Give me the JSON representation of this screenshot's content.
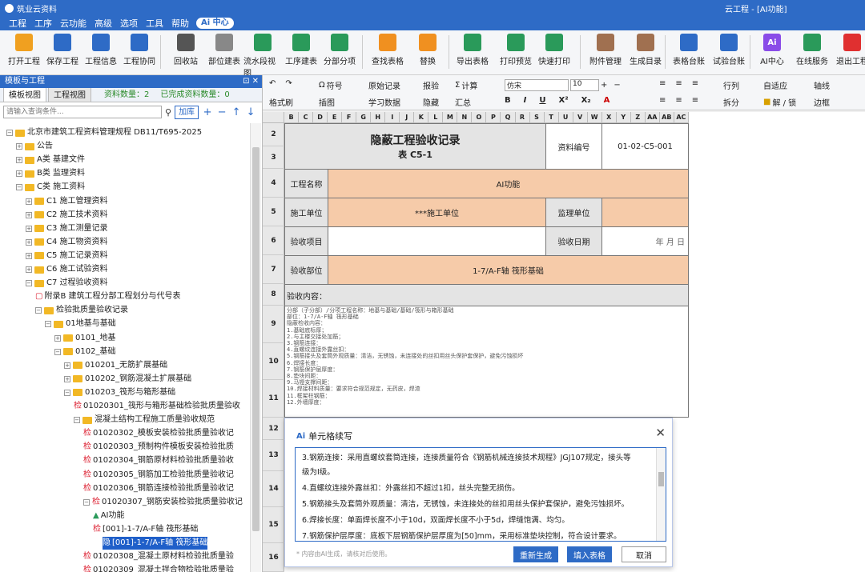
{
  "window": {
    "app_name": "筑业云资料",
    "title": "云工程 - [AI功能]"
  },
  "menu": [
    "工程",
    "工序",
    "云功能",
    "高级",
    "选项",
    "工具",
    "帮助"
  ],
  "menu_ai": "Ai 中心",
  "ribbon": {
    "items": [
      "打开工程",
      "保存工程",
      "工程信息",
      "工程协同",
      "回收站",
      "部位建表",
      "流水段视图",
      "工序建表",
      "分部分项",
      "查找表格",
      "替换",
      "导出表格",
      "打印预览",
      "快速打印",
      "附件管理",
      "生成目录",
      "表格台账",
      "试验台账",
      "AI中心",
      "在线服务",
      "退出工程"
    ]
  },
  "panel": {
    "title": "模板与工程",
    "tabs": [
      "模板视图",
      "工程视图"
    ],
    "material_count": "资料数量：2",
    "done_count": "已完成资料数量：0",
    "search_placeholder": "请输入查询条件...",
    "add_label": "加库"
  },
  "tree": [
    {
      "label": "北京市建筑工程资料管理规程 DB11/T695-2025",
      "level": 0,
      "type": "folder",
      "toggle": "−"
    },
    {
      "label": "公告",
      "level": 1,
      "type": "folder",
      "toggle": "+"
    },
    {
      "label": "A类 基建文件",
      "level": 1,
      "type": "folder",
      "toggle": "+"
    },
    {
      "label": "B类 监理资料",
      "level": 1,
      "type": "folder",
      "toggle": "+"
    },
    {
      "label": "C类 施工资料",
      "level": 1,
      "type": "folder",
      "toggle": "−"
    },
    {
      "label": "C1 施工管理资料",
      "level": 2,
      "type": "folder",
      "toggle": "+"
    },
    {
      "label": "C2 施工技术资料",
      "level": 2,
      "type": "folder",
      "toggle": "+"
    },
    {
      "label": "C3 施工测量记录",
      "level": 2,
      "type": "folder",
      "toggle": "+"
    },
    {
      "label": "C4 施工物资资料",
      "level": 2,
      "type": "folder",
      "toggle": "+"
    },
    {
      "label": "C5 施工记录资料",
      "level": 2,
      "type": "folder",
      "toggle": "+"
    },
    {
      "label": "C6 施工试验资料",
      "level": 2,
      "type": "folder",
      "toggle": "+"
    },
    {
      "label": "C7 过程验收资料",
      "level": 2,
      "type": "folder",
      "toggle": "−"
    },
    {
      "label": "附录B 建筑工程分部工程划分与代号表",
      "level": 3,
      "type": "pdf",
      "toggle": ""
    },
    {
      "label": "检验批质量验收记录",
      "level": 3,
      "type": "folder",
      "toggle": "−"
    },
    {
      "label": "01地基与基础",
      "level": 4,
      "type": "folder",
      "toggle": "−"
    },
    {
      "label": "0101_地基",
      "level": 5,
      "type": "folder",
      "toggle": "+"
    },
    {
      "label": "0102_基础",
      "level": 5,
      "type": "folder",
      "toggle": "−"
    },
    {
      "label": "010201_无筋扩展基础",
      "level": 6,
      "type": "folder",
      "toggle": "+"
    },
    {
      "label": "010202_钢筋混凝土扩展基础",
      "level": 6,
      "type": "folder",
      "toggle": "+"
    },
    {
      "label": "010203_筏形与箱形基础",
      "level": 6,
      "type": "folder",
      "toggle": "−"
    },
    {
      "label": "01020301_筏形与箱形基础检验批质量验收",
      "level": 7,
      "type": "jian",
      "toggle": ""
    },
    {
      "label": "混凝土结构工程施工质量验收规范",
      "level": 7,
      "type": "folder",
      "toggle": "−"
    },
    {
      "label": "01020302_模板安装检验批质量验收记",
      "level": 8,
      "type": "jian",
      "toggle": ""
    },
    {
      "label": "01020303_预制构件模板安装检验批质",
      "level": 8,
      "type": "jian",
      "toggle": ""
    },
    {
      "label": "01020304_钢筋原材料检验批质量验收",
      "level": 8,
      "type": "jian",
      "toggle": ""
    },
    {
      "label": "01020305_钢筋加工检验批质量验收记",
      "level": 8,
      "type": "jian",
      "toggle": ""
    },
    {
      "label": "01020306_钢筋连接检验批质量验收记",
      "level": 8,
      "type": "jian",
      "toggle": ""
    },
    {
      "label": "01020307_钢筋安装检验批质量验收记",
      "level": 8,
      "type": "jian",
      "toggle": "−"
    },
    {
      "label": "AI功能",
      "level": 9,
      "type": "home",
      "toggle": ""
    },
    {
      "label": "[001]-1-7/A-F轴 筏形基础",
      "level": 9,
      "type": "jian",
      "toggle": ""
    },
    {
      "label": "[001]-1-7/A-F轴 筏形基础",
      "level": 10,
      "type": "yin",
      "toggle": "",
      "selected": true
    },
    {
      "label": "01020308_混凝土原材料检验批质量验",
      "level": 8,
      "type": "jian",
      "toggle": ""
    },
    {
      "label": "01020309_混凝土拌合物检验批质量验",
      "level": 8,
      "type": "jian",
      "toggle": ""
    }
  ],
  "toolbar2": {
    "symbol": "符号",
    "original_record": "原始记录",
    "report": "报验",
    "calc": "计算",
    "font": "仿宋",
    "size": "10",
    "rowcol": "行列",
    "autofit": "自适应",
    "axis": "轴线",
    "format_brush": "格式刷",
    "illustration": "插图",
    "learn_data": "学习数据",
    "hide": "隐藏",
    "summary": "汇总",
    "split": "拆分",
    "unlock": "解 / 锁",
    "border": "边框"
  },
  "columns": [
    "B",
    "C",
    "D",
    "E",
    "F",
    "G",
    "H",
    "I",
    "J",
    "K",
    "L",
    "M",
    "N",
    "O",
    "P",
    "Q",
    "R",
    "S",
    "T",
    "U",
    "V",
    "W",
    "X",
    "Y",
    "Z",
    "AA",
    "AB",
    "AC"
  ],
  "rows": [
    "2",
    "3",
    "4",
    "5",
    "6",
    "7",
    "8",
    "9",
    "10",
    "11",
    "12",
    "13",
    "14",
    "15",
    "16"
  ],
  "form": {
    "title": "隐蔽工程验收记录",
    "subtitle": "表 C5-1",
    "doc_no_label": "资料编号",
    "doc_no": "01-02-C5-001",
    "project_name_label": "工程名称",
    "project_name": "AI功能",
    "construction_unit_label": "施工单位",
    "construction_unit": "***施工单位",
    "supervision_label": "监理单位",
    "inspection_item_label": "验收项目",
    "inspection_date_label": "验收日期",
    "date_value": "年   月   日",
    "inspection_part_label": "验收部位",
    "inspection_part": "1-7/A-F轴 筏形基础",
    "content_label": "验收内容：",
    "content_lines": [
      "分部（子分部）/分项工程名称：地基与基础/基础/筏形与箱形基础",
      "部位：1-7/A-F轴 筏形基础",
      "隐蔽检收内容：",
      "1.基础底标厚；",
      "2.与主楼交接处加筋；",
      "3.钢筋连接：",
      "4.直螺纹连接外露丝扣：",
      "5.钢筋接头及套筒外观质量：清洁，无锈蚀，未连接处的丝扣用丝头保护套保护，避免污蚀损坏",
      "6.焊接长度：",
      "7.钢筋保护层厚度：",
      "8.垫块间距：",
      "9.马镫支撑间距：",
      "10.焊接材料质量：要求符合规范规定，无药皮，焊渣",
      "11.框架柱钢筋：",
      "12.外墙厚度："
    ]
  },
  "dialog": {
    "title": "单元格续写",
    "ai_label": "Ai",
    "lines": [
      "3.钢筋连接：采用直螺纹套筒连接，连接质量符合《钢筋机械连接技术规程》JGJ107规定，接头等",
      "级为I级。",
      "4.直螺纹连接外露丝扣：外露丝扣不超过1扣，丝头完整无损伤。",
      "5.钢筋接头及套筒外观质量：清洁，无锈蚀，未连接处的丝扣用丝头保护套保护，避免污蚀损坏。",
      "6.焊接长度：单面焊长度不小于10d，双面焊长度不小于5d，焊缝饱满、均匀。",
      "7.钢筋保护层厚度：底板下层钢筋保护层厚度为[50]mm，采用标准垫块控制，符合设计要求。"
    ],
    "note": "* 内容由AI生成，请核对后使用。",
    "regenerate": "重新生成",
    "fill": "填入表格",
    "cancel": "取消"
  },
  "colors": {
    "accent": "#2e6bc6",
    "peach": "#f6cba9"
  }
}
